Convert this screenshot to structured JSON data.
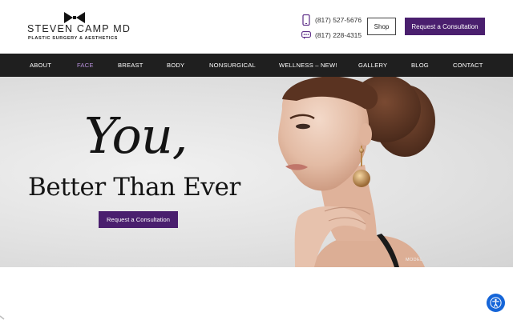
{
  "brand": {
    "name": "STEVEN CAMP MD",
    "tagline": "PLASTIC SURGERY & AESTHETICS"
  },
  "contact": {
    "phone_primary": "(817) 527-5676",
    "phone_text": "(817) 228-4315"
  },
  "header_buttons": {
    "shop": "Shop",
    "consultation": "Request a Consultation"
  },
  "nav": {
    "items": [
      {
        "label": "ABOUT"
      },
      {
        "label": "FACE"
      },
      {
        "label": "BREAST"
      },
      {
        "label": "BODY"
      },
      {
        "label": "NONSURGICAL"
      },
      {
        "label": "WELLNESS – NEW!"
      },
      {
        "label": "GALLERY"
      },
      {
        "label": "BLOG"
      },
      {
        "label": "CONTACT"
      }
    ],
    "active": "FACE"
  },
  "hero": {
    "headline": "You,",
    "subheadline": "Better Than Ever",
    "cta": "Request a Consultation",
    "image_caption": "MODEL"
  },
  "colors": {
    "brand_purple": "#4a1f6e",
    "nav_bg": "#1f1f1f",
    "nav_active": "#b58fd8",
    "a11y_blue": "#1565d8"
  },
  "icons": {
    "phone": "phone-icon",
    "text": "chat-bubble-icon",
    "logo_mark": "bowtie-icon",
    "accessibility": "accessibility-icon"
  }
}
